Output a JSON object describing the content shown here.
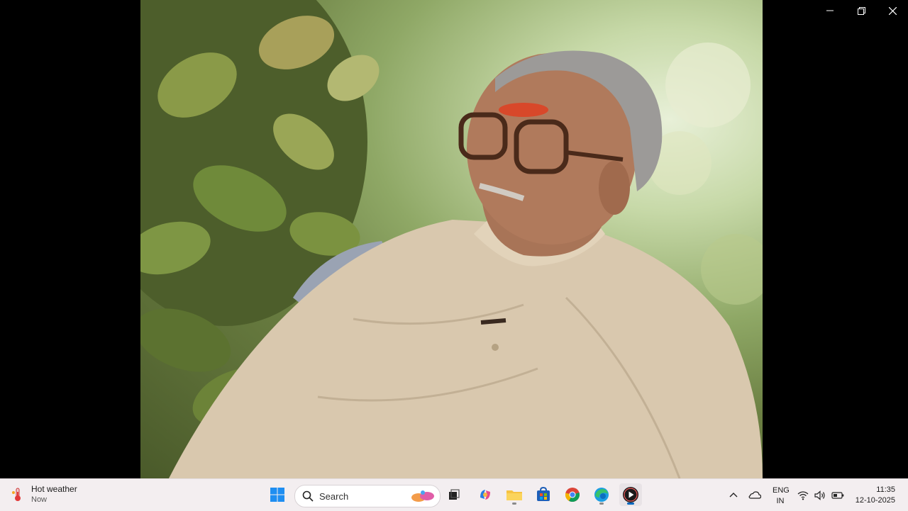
{
  "window": {
    "controls": [
      "minimize",
      "restore",
      "close"
    ]
  },
  "video": {
    "description_icon": "video-frame"
  },
  "taskbar": {
    "widget": {
      "title": "Hot weather",
      "subtitle": "Now",
      "icon": "thermometer-icon"
    },
    "search": {
      "placeholder": "Search"
    },
    "pinned_apps": [
      "start-icon",
      "search-icon",
      "task-view-icon",
      "copilot-icon",
      "file-explorer-icon",
      "microsoft-store-icon",
      "chrome-icon",
      "edge-icon",
      "media-player-icon"
    ],
    "tray": {
      "language_line1": "ENG",
      "language_line2": "IN",
      "time": "11:35",
      "date": "12-10-2025"
    }
  }
}
